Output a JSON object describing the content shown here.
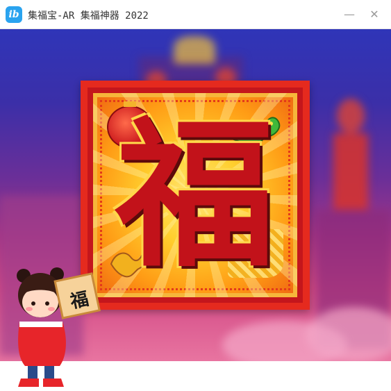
{
  "window": {
    "app_icon_text": "ib",
    "title": "集福宝-AR 集福神器 2022",
    "minimize_glyph": "—",
    "close_glyph": "✕"
  },
  "fu_card": {
    "character": "福"
  },
  "mascot": {
    "sign_text": "福"
  },
  "icons": {
    "app": "app-logo-icon",
    "lantern": "red-lantern-icon",
    "dragon": "green-dragon-icon",
    "dragon_small": "gold-dragon-icon",
    "mascot": "mascot-girl-icon"
  },
  "colors": {
    "card_red": "#e52a1e",
    "card_gold": "#ffcf2e",
    "app_icon_blue": "#2aa3ef",
    "scene_top": "#2f35b8",
    "scene_bottom": "#e874a0"
  }
}
